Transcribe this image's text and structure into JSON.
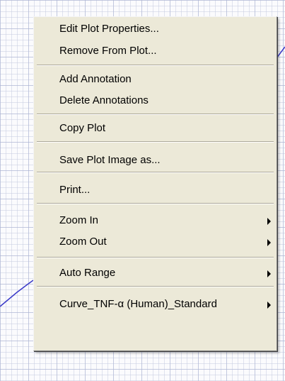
{
  "menu": {
    "items": [
      {
        "label": "Edit Plot Properties...",
        "has_submenu": false
      },
      {
        "label": "Remove From Plot...",
        "has_submenu": false
      },
      {
        "label": "Add Annotation",
        "has_submenu": false
      },
      {
        "label": "Delete Annotations",
        "has_submenu": false
      },
      {
        "label": "Copy Plot",
        "has_submenu": false
      },
      {
        "label": "Save Plot Image as...",
        "has_submenu": false
      },
      {
        "label": "Print...",
        "has_submenu": false
      },
      {
        "label": "Zoom In",
        "has_submenu": true
      },
      {
        "label": "Zoom Out",
        "has_submenu": true
      },
      {
        "label": "Auto Range",
        "has_submenu": true
      },
      {
        "label": "Curve_TNF-α (Human)_Standard",
        "has_submenu": true
      }
    ]
  },
  "colors": {
    "curve": "#3a3ac8",
    "menu_background": "#ece9d8",
    "highlight": "#316ac5"
  }
}
